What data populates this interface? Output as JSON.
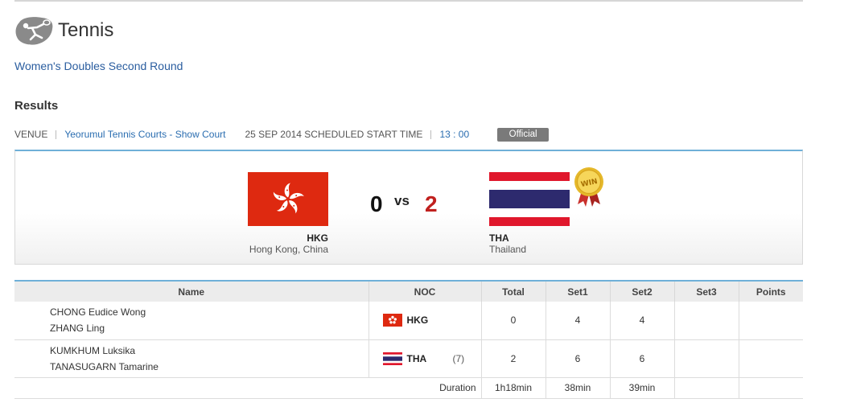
{
  "header": {
    "sport": "Tennis",
    "icon": "tennis-player-icon"
  },
  "event": {
    "title": "Women's Doubles Second Round"
  },
  "results": {
    "heading": "Results"
  },
  "info": {
    "venue_label": "VENUE",
    "venue_name": "Yeorumul Tennis Courts - Show Court",
    "date_time_label": "25 SEP 2014 SCHEDULED START TIME",
    "time": "13 : 00",
    "status": "Official"
  },
  "match": {
    "home": {
      "code": "HKG",
      "name": "Hong Kong, China",
      "score": "0",
      "flag": "hong-kong-flag"
    },
    "away": {
      "code": "THA",
      "name": "Thailand",
      "score": "2",
      "flag": "thailand-flag"
    },
    "vs": "vs",
    "win_badge": "WIN",
    "colors": {
      "accent": "#6fb0d8",
      "away_score": "#c0201e",
      "hk_red": "#de2910",
      "th_red": "#e0172c",
      "th_blue": "#2d2a6e"
    }
  },
  "table": {
    "headers": [
      "Name",
      "NOC",
      "Total",
      "Set1",
      "Set2",
      "Set3",
      "Points"
    ],
    "rows": [
      {
        "players": [
          "CHONG Eudice Wong",
          "ZHANG Ling"
        ],
        "noc": "HKG",
        "seed": "",
        "total": "0",
        "set1": "4",
        "set2": "4",
        "set3": "",
        "points": ""
      },
      {
        "players": [
          "KUMKHUM Luksika",
          "TANASUGARN Tamarine"
        ],
        "noc": "THA",
        "seed": "(7)",
        "total": "2",
        "set1": "6",
        "set2": "6",
        "set3": "",
        "points": ""
      }
    ],
    "duration": {
      "label": "Duration",
      "total": "1h18min",
      "set1": "38min",
      "set2": "39min",
      "set3": "",
      "points": ""
    }
  }
}
